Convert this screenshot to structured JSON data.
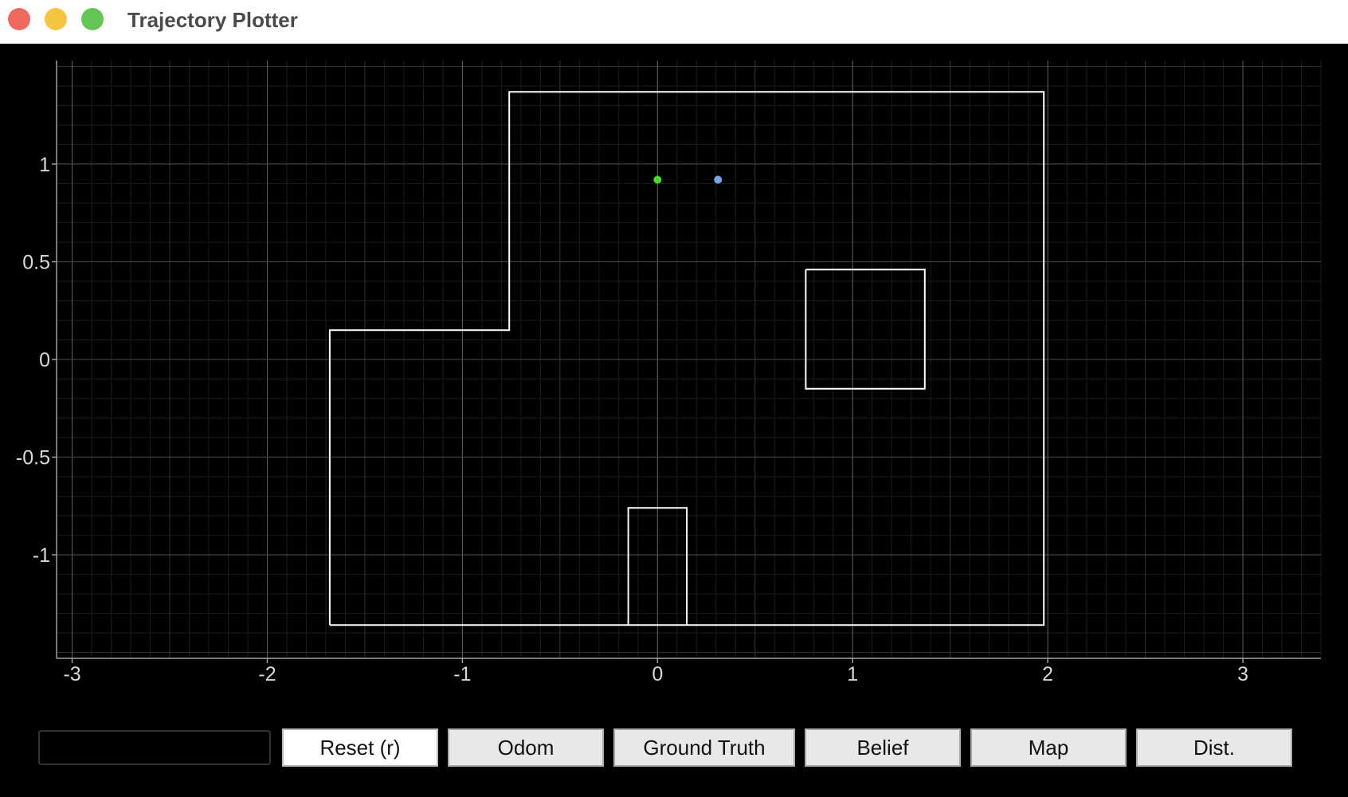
{
  "window": {
    "title": "Trajectory Plotter",
    "traffic_lights": [
      {
        "name": "close",
        "color": "#ee6a5f"
      },
      {
        "name": "minimize",
        "color": "#f5c440"
      },
      {
        "name": "maximize",
        "color": "#62c554"
      }
    ]
  },
  "chart_data": {
    "type": "scatter",
    "xlim": [
      -3.08,
      3.4
    ],
    "ylim": [
      -1.53,
      1.53
    ],
    "x_ticks": [
      -3,
      -2,
      -1,
      0,
      1,
      2,
      3
    ],
    "y_ticks": [
      -1,
      -0.5,
      0,
      0.5,
      1
    ],
    "grid": true,
    "background": "#000000",
    "points": [
      {
        "x": 0.0,
        "y": 0.92,
        "color": "#44dd22"
      },
      {
        "x": 0.31,
        "y": 0.92,
        "color": "#6fa8e8"
      }
    ],
    "map_color": "#ffffff",
    "map_lines": [
      [
        [
          -1.68,
          -1.36
        ],
        [
          -1.68,
          0.15
        ],
        [
          -0.76,
          0.15
        ],
        [
          -0.76,
          1.37
        ],
        [
          1.98,
          1.37
        ],
        [
          1.98,
          -1.36
        ],
        [
          -1.68,
          -1.36
        ]
      ],
      [
        [
          0.76,
          0.46
        ],
        [
          1.37,
          0.46
        ],
        [
          1.37,
          -0.15
        ],
        [
          0.76,
          -0.15
        ],
        [
          0.76,
          0.46
        ]
      ],
      [
        [
          -0.15,
          -1.36
        ],
        [
          -0.15,
          -0.76
        ],
        [
          0.15,
          -0.76
        ],
        [
          0.15,
          -1.36
        ]
      ]
    ]
  },
  "controls": {
    "input_value": "",
    "buttons": [
      {
        "key": "reset",
        "label": "Reset (r)"
      },
      {
        "key": "odom",
        "label": "Odom"
      },
      {
        "key": "ground_truth",
        "label": "Ground Truth"
      },
      {
        "key": "belief",
        "label": "Belief"
      },
      {
        "key": "map",
        "label": "Map"
      },
      {
        "key": "dist",
        "label": "Dist."
      }
    ]
  }
}
